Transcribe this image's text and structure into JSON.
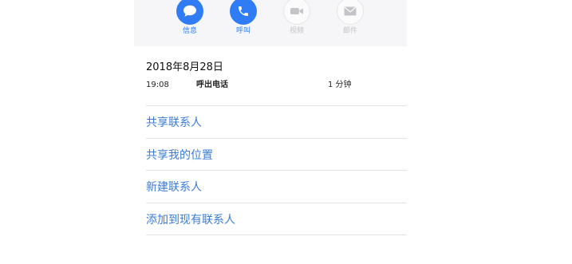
{
  "actions": [
    {
      "label": "信息",
      "icon": "message-bubble-icon",
      "enabled": true
    },
    {
      "label": "呼叫",
      "icon": "phone-icon",
      "enabled": true
    },
    {
      "label": "视频",
      "icon": "video-camera-icon",
      "enabled": false
    },
    {
      "label": "邮件",
      "icon": "mail-envelope-icon",
      "enabled": false
    }
  ],
  "history": {
    "date": "2018年8月28日",
    "time": "19:08",
    "type": "呼出电话",
    "duration": "1 分钟"
  },
  "menu": [
    {
      "label": "共享联系人"
    },
    {
      "label": "共享我的位置"
    },
    {
      "label": "新建联系人"
    },
    {
      "label": "添加到现有联系人"
    }
  ],
  "colors": {
    "accent": "#2f7cf6",
    "link": "#3a7cd8",
    "disabled": "#c4c4c8",
    "action_bar_bg": "#f6f6f8",
    "divider": "#e3e3e6"
  }
}
